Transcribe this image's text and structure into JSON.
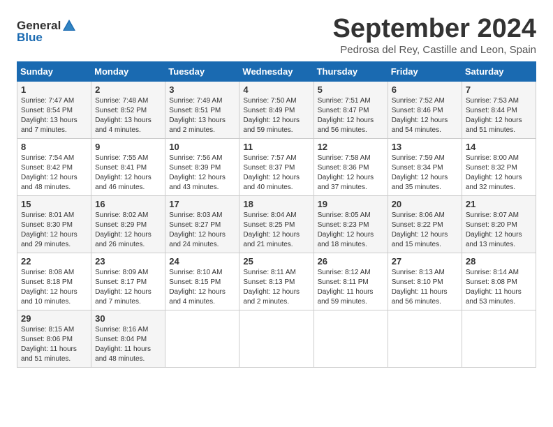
{
  "header": {
    "logo_general": "General",
    "logo_blue": "Blue",
    "title": "September 2024",
    "subtitle": "Pedrosa del Rey, Castille and Leon, Spain"
  },
  "columns": [
    "Sunday",
    "Monday",
    "Tuesday",
    "Wednesday",
    "Thursday",
    "Friday",
    "Saturday"
  ],
  "weeks": [
    [
      {
        "num": "1",
        "info": "Sunrise: 7:47 AM\nSunset: 8:54 PM\nDaylight: 13 hours and 7 minutes."
      },
      {
        "num": "2",
        "info": "Sunrise: 7:48 AM\nSunset: 8:52 PM\nDaylight: 13 hours and 4 minutes."
      },
      {
        "num": "3",
        "info": "Sunrise: 7:49 AM\nSunset: 8:51 PM\nDaylight: 13 hours and 2 minutes."
      },
      {
        "num": "4",
        "info": "Sunrise: 7:50 AM\nSunset: 8:49 PM\nDaylight: 12 hours and 59 minutes."
      },
      {
        "num": "5",
        "info": "Sunrise: 7:51 AM\nSunset: 8:47 PM\nDaylight: 12 hours and 56 minutes."
      },
      {
        "num": "6",
        "info": "Sunrise: 7:52 AM\nSunset: 8:46 PM\nDaylight: 12 hours and 54 minutes."
      },
      {
        "num": "7",
        "info": "Sunrise: 7:53 AM\nSunset: 8:44 PM\nDaylight: 12 hours and 51 minutes."
      }
    ],
    [
      {
        "num": "8",
        "info": "Sunrise: 7:54 AM\nSunset: 8:42 PM\nDaylight: 12 hours and 48 minutes."
      },
      {
        "num": "9",
        "info": "Sunrise: 7:55 AM\nSunset: 8:41 PM\nDaylight: 12 hours and 46 minutes."
      },
      {
        "num": "10",
        "info": "Sunrise: 7:56 AM\nSunset: 8:39 PM\nDaylight: 12 hours and 43 minutes."
      },
      {
        "num": "11",
        "info": "Sunrise: 7:57 AM\nSunset: 8:37 PM\nDaylight: 12 hours and 40 minutes."
      },
      {
        "num": "12",
        "info": "Sunrise: 7:58 AM\nSunset: 8:36 PM\nDaylight: 12 hours and 37 minutes."
      },
      {
        "num": "13",
        "info": "Sunrise: 7:59 AM\nSunset: 8:34 PM\nDaylight: 12 hours and 35 minutes."
      },
      {
        "num": "14",
        "info": "Sunrise: 8:00 AM\nSunset: 8:32 PM\nDaylight: 12 hours and 32 minutes."
      }
    ],
    [
      {
        "num": "15",
        "info": "Sunrise: 8:01 AM\nSunset: 8:30 PM\nDaylight: 12 hours and 29 minutes."
      },
      {
        "num": "16",
        "info": "Sunrise: 8:02 AM\nSunset: 8:29 PM\nDaylight: 12 hours and 26 minutes."
      },
      {
        "num": "17",
        "info": "Sunrise: 8:03 AM\nSunset: 8:27 PM\nDaylight: 12 hours and 24 minutes."
      },
      {
        "num": "18",
        "info": "Sunrise: 8:04 AM\nSunset: 8:25 PM\nDaylight: 12 hours and 21 minutes."
      },
      {
        "num": "19",
        "info": "Sunrise: 8:05 AM\nSunset: 8:23 PM\nDaylight: 12 hours and 18 minutes."
      },
      {
        "num": "20",
        "info": "Sunrise: 8:06 AM\nSunset: 8:22 PM\nDaylight: 12 hours and 15 minutes."
      },
      {
        "num": "21",
        "info": "Sunrise: 8:07 AM\nSunset: 8:20 PM\nDaylight: 12 hours and 13 minutes."
      }
    ],
    [
      {
        "num": "22",
        "info": "Sunrise: 8:08 AM\nSunset: 8:18 PM\nDaylight: 12 hours and 10 minutes."
      },
      {
        "num": "23",
        "info": "Sunrise: 8:09 AM\nSunset: 8:17 PM\nDaylight: 12 hours and 7 minutes."
      },
      {
        "num": "24",
        "info": "Sunrise: 8:10 AM\nSunset: 8:15 PM\nDaylight: 12 hours and 4 minutes."
      },
      {
        "num": "25",
        "info": "Sunrise: 8:11 AM\nSunset: 8:13 PM\nDaylight: 12 hours and 2 minutes."
      },
      {
        "num": "26",
        "info": "Sunrise: 8:12 AM\nSunset: 8:11 PM\nDaylight: 11 hours and 59 minutes."
      },
      {
        "num": "27",
        "info": "Sunrise: 8:13 AM\nSunset: 8:10 PM\nDaylight: 11 hours and 56 minutes."
      },
      {
        "num": "28",
        "info": "Sunrise: 8:14 AM\nSunset: 8:08 PM\nDaylight: 11 hours and 53 minutes."
      }
    ],
    [
      {
        "num": "29",
        "info": "Sunrise: 8:15 AM\nSunset: 8:06 PM\nDaylight: 11 hours and 51 minutes."
      },
      {
        "num": "30",
        "info": "Sunrise: 8:16 AM\nSunset: 8:04 PM\nDaylight: 11 hours and 48 minutes."
      },
      {
        "num": "",
        "info": ""
      },
      {
        "num": "",
        "info": ""
      },
      {
        "num": "",
        "info": ""
      },
      {
        "num": "",
        "info": ""
      },
      {
        "num": "",
        "info": ""
      }
    ]
  ]
}
